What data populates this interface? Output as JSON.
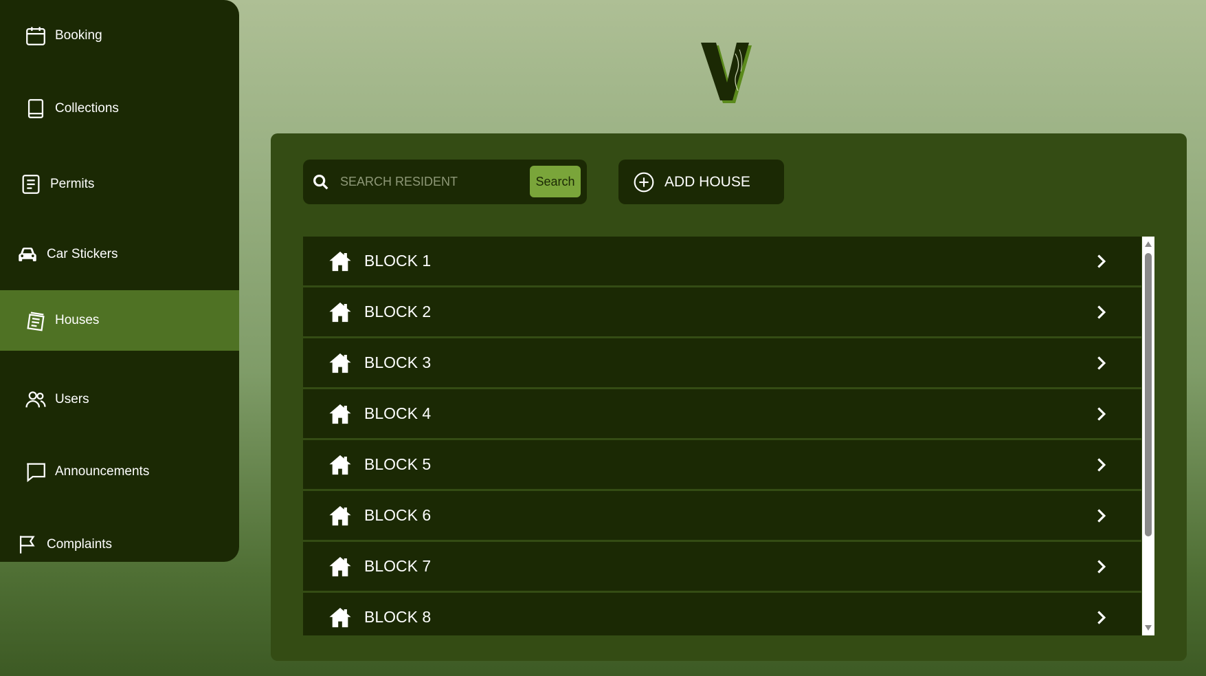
{
  "colors": {
    "sidebar_bg": "#1b2904",
    "active_bg": "#4f7224",
    "panel_bg": "#344c14",
    "accent": "#7aa53a"
  },
  "sidebar": {
    "items": [
      {
        "label": "Booking",
        "icon": "calendar-icon"
      },
      {
        "label": "Collections",
        "icon": "book-icon"
      },
      {
        "label": "Permits",
        "icon": "document-icon"
      },
      {
        "label": "Car Stickers",
        "icon": "car-icon"
      },
      {
        "label": "Houses",
        "icon": "houses-icon",
        "active": true
      },
      {
        "label": "Users",
        "icon": "users-icon"
      },
      {
        "label": "Announcements",
        "icon": "chat-icon"
      },
      {
        "label": "Complaints",
        "icon": "flag-icon"
      }
    ]
  },
  "toolbar": {
    "search_placeholder": "SEARCH RESIDENT",
    "search_value": "",
    "search_button": "Search",
    "add_button": "ADD HOUSE"
  },
  "blocks": [
    {
      "label": "BLOCK 1"
    },
    {
      "label": "BLOCK 2"
    },
    {
      "label": "BLOCK 3"
    },
    {
      "label": "BLOCK 4"
    },
    {
      "label": "BLOCK 5"
    },
    {
      "label": "BLOCK 6"
    },
    {
      "label": "BLOCK 7"
    },
    {
      "label": "BLOCK 8"
    }
  ]
}
